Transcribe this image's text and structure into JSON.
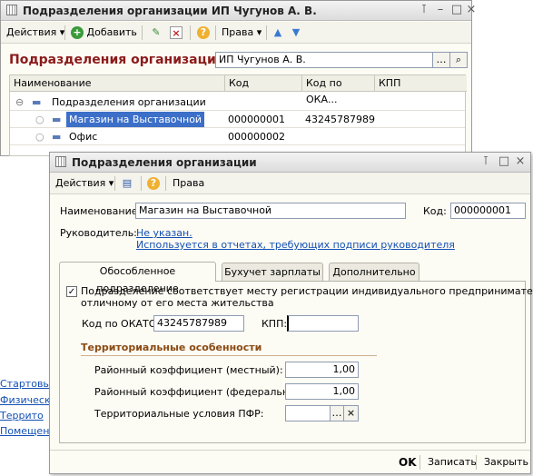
{
  "bg_window": {
    "title": "Подразделения организации ИП Чугунов А. В.",
    "toolbar": {
      "actions_label": "Действия",
      "add_label": "Добавить",
      "rights_label": "Права"
    },
    "heading": "Подразделения организации",
    "org_value": "ИП Чугунов А. В.",
    "columns": [
      "Наименование",
      "Код",
      "Код по ОКА...",
      "КПП"
    ],
    "root_label": "Подразделения организации",
    "rows": [
      {
        "name": "Магазин на Выставочной",
        "code": "000000001",
        "okato": "43245787989",
        "kpp": ""
      },
      {
        "name": "Офис",
        "code": "000000002",
        "okato": "",
        "kpp": ""
      }
    ]
  },
  "left_links": [
    "Стартовы",
    "Физическ",
    "Террито",
    "Помещен"
  ],
  "form": {
    "title": "Подразделения организации",
    "toolbar": {
      "actions_label": "Действия",
      "rights_label": "Права"
    },
    "name_label": "Наименование:",
    "name_value": "Магазин на Выставочной",
    "code_label": "Код:",
    "code_value": "000000001",
    "head_label": "Руководитель:",
    "head_value": "Не указан.",
    "head_hint": "Используется в отчетах, требующих подписи руководителя",
    "tabs": [
      "Обособленное подразделение",
      "Бухучет зарплаты",
      "Дополнительно"
    ],
    "checkbox_text_1": "Подразделение соответствует месту регистрации индивидуального предпринимателя,",
    "checkbox_text_2": "отличному от его места жительства",
    "checkbox_checked": true,
    "okato_label": "Код по ОКАТО:",
    "okato_value": "43245787989",
    "kpp_label": "КПП:",
    "kpp_value": "",
    "section_title": "Территориальные особенности",
    "coef_local_label": "Районный коэффициент (местный):",
    "coef_local_value": "1,00",
    "coef_fed_label": "Районный коэффициент (федеральный):",
    "coef_fed_value": "1,00",
    "pfr_label": "Территориальные условия ПФР:",
    "pfr_value": "",
    "buttons": {
      "ok": "OK",
      "save": "Записать",
      "close": "Закрыть"
    }
  },
  "colors": {
    "heading": "#8b1a1a",
    "link": "#1450b4",
    "section": "#8b4a12",
    "selection": "#3c6fc8"
  }
}
